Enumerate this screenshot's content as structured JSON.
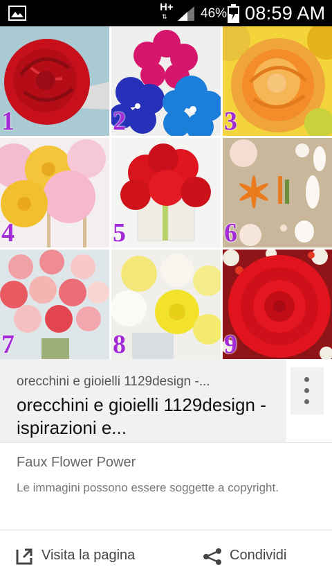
{
  "status_bar": {
    "network_type": "H+",
    "battery_percent": "46%",
    "time": "08:59 AM",
    "icons": [
      "gallery-icon",
      "signal-icon",
      "battery-icon"
    ]
  },
  "collage": {
    "tile_numbers": [
      "1",
      "2",
      "3",
      "4",
      "5",
      "6",
      "7",
      "8",
      "9"
    ],
    "number_color": "#a22bd6"
  },
  "result": {
    "source": "orecchini e gioielli 1129design -...",
    "title": "orecchini e gioielli 1129design - ispirazioni e...",
    "related": "Faux Flower Power",
    "copyright_note": "Le immagini possono essere soggette a copyright.",
    "visit_label": "Visita la pagina",
    "share_label": "Condividi"
  }
}
